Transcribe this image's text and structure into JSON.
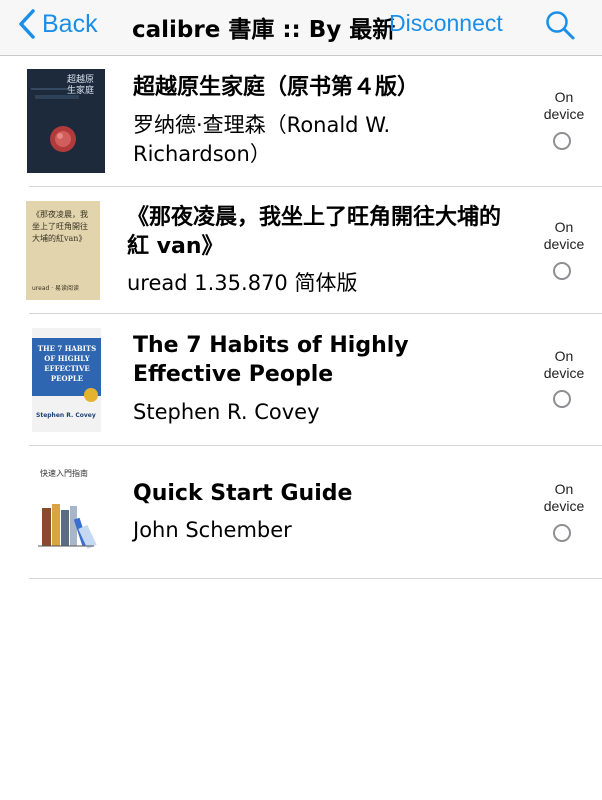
{
  "navbar": {
    "back_label": "Back",
    "title": "calibre 書庫 :: By 最新",
    "disconnect_label": "Disconnect",
    "search_icon": "search-icon",
    "accent_color": "#1a8ee8"
  },
  "books": [
    {
      "title": "超越原生家庭（原书第４版）",
      "author": "罗纳德·查理森（Ronald W. Richardson）",
      "cover_text": "超越原生家庭",
      "status_label": "On device",
      "on_device": false
    },
    {
      "title": "《那夜凌晨，我坐上了旺角開往大埔的紅 van》",
      "author": "uread 1.35.870 简体版",
      "cover_text": "《那夜凌晨，我坐上了旺角開往大埔的紅van》",
      "cover_footer": "uread · 易读阅读",
      "status_label": "On device",
      "on_device": false
    },
    {
      "title": "The 7 Habits of Highly Effective People",
      "author": "Stephen R. Covey",
      "cover_text": "THE 7 HABITS OF HIGHLY EFFECTIVE PEOPLE",
      "cover_author": "Stephen R. Covey",
      "status_label": "On device",
      "on_device": false
    },
    {
      "title": "Quick Start Guide",
      "author": "John Schember",
      "cover_text": "快速入門指南",
      "status_label": "On device",
      "on_device": false
    }
  ]
}
